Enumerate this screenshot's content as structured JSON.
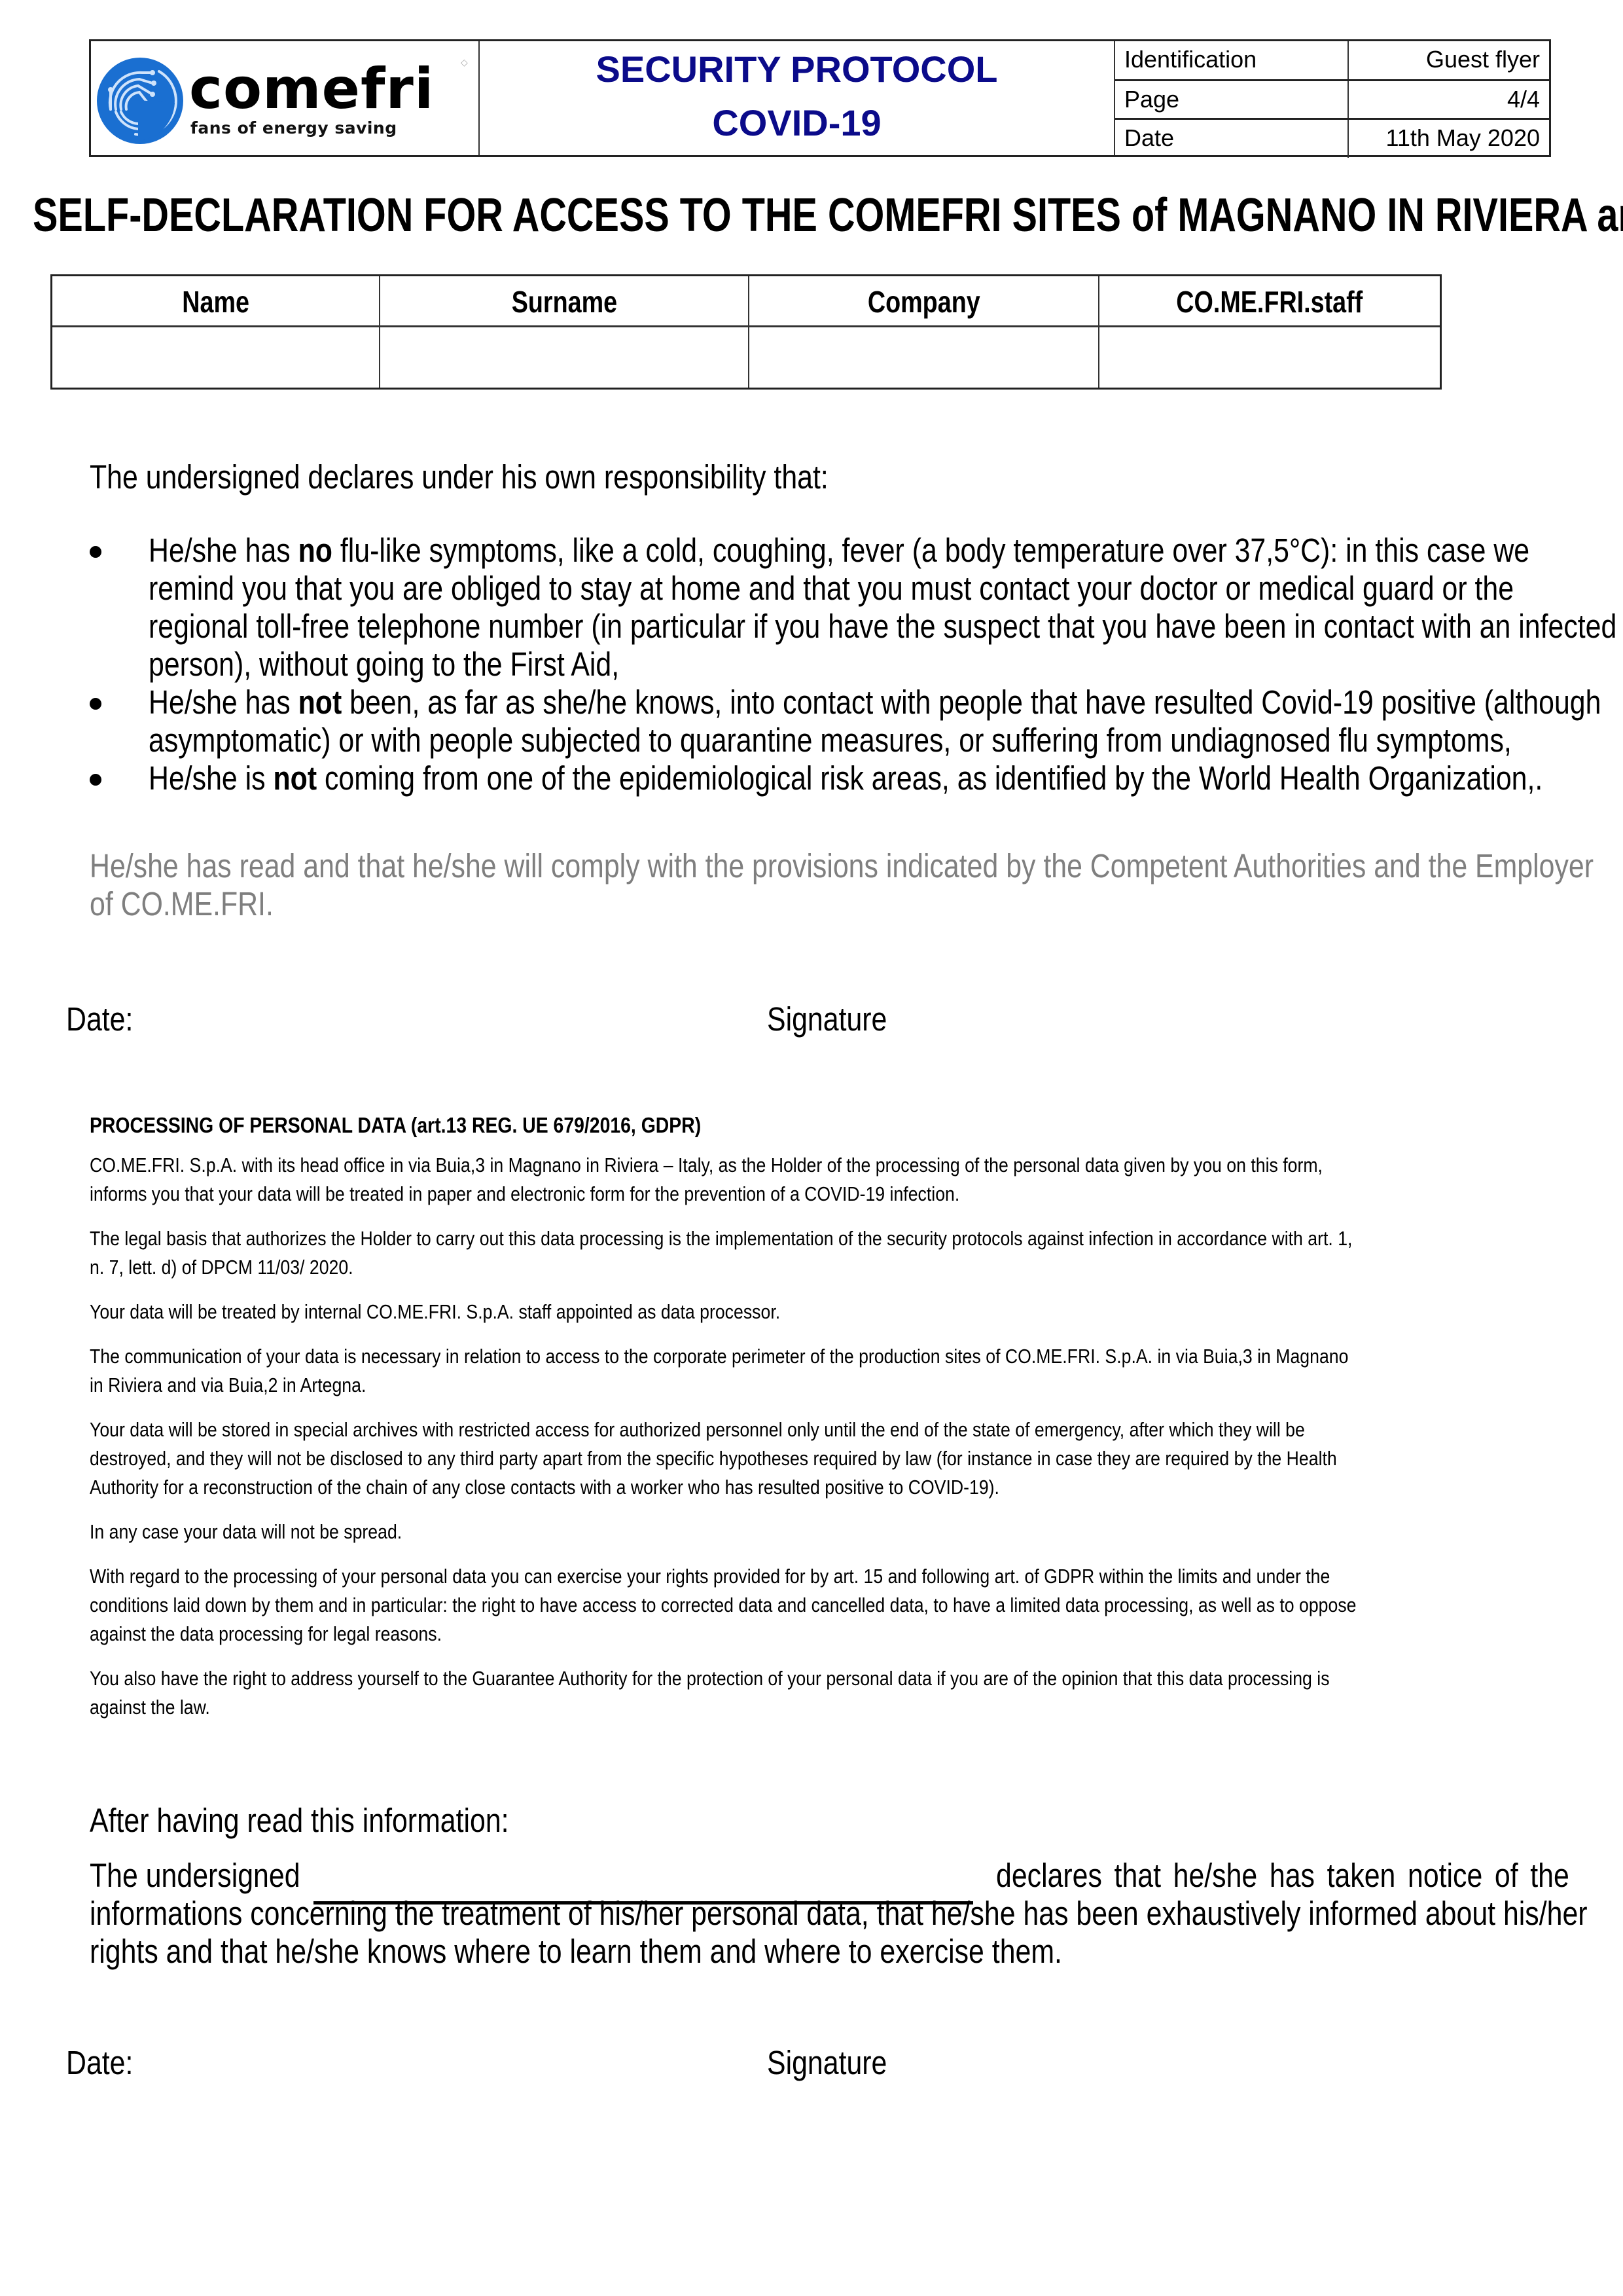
{
  "header": {
    "logo": {
      "brand": "comefri",
      "tagline": "fans of energy saving",
      "icon": "fan-circle-logo-icon",
      "brand_color": "#1a6fd1"
    },
    "protocol_title_line1": "SECURITY PROTOCOL",
    "protocol_title_line2": "COVID-19",
    "protocol_title_color": "#0b0b8a",
    "info": [
      {
        "label": "Identification",
        "value": "Guest flyer"
      },
      {
        "label": "Page",
        "value": "4/4"
      },
      {
        "label": "Date",
        "value": "11th May 2020"
      }
    ]
  },
  "title": "SELF-DECLARATION FOR ACCESS TO THE COMEFRI SITES of MAGNANO IN RIVIERA and ARTEGNA",
  "person_table": {
    "columns": [
      "Name",
      "Surname",
      "Company",
      "CO.ME.FRI.staff"
    ],
    "row": [
      "",
      "",
      "",
      ""
    ]
  },
  "declaration": {
    "intro": "The undersigned declares under his own responsibility that:",
    "bullets": [
      {
        "lines": [
          {
            "pre": "He/she has ",
            "bold": "no",
            "post": " flu-like symptoms, like a cold, coughing, fever (a body temperature over 37,5°C): in this case we"
          },
          {
            "pre": "remind you that you are obliged to stay at home and that you must contact your doctor or medical guard or the",
            "bold": "",
            "post": ""
          },
          {
            "pre": "regional toll-free telephone number (in particular if you have the suspect that you have been in contact with an infected",
            "bold": "",
            "post": ""
          },
          {
            "pre": "person), without going to the First Aid,",
            "bold": "",
            "post": ""
          }
        ]
      },
      {
        "lines": [
          {
            "pre": "He/she has ",
            "bold": "not",
            "post": " been, as far as she/he knows, into contact with people that have resulted Covid-19 positive (although"
          },
          {
            "pre": "asymptomatic) or with people subjected to quarantine measures, or suffering from undiagnosed flu symptoms,",
            "bold": "",
            "post": ""
          }
        ]
      },
      {
        "lines": [
          {
            "pre": "He/she is ",
            "bold": "not",
            "post": " coming  from one of the epidemiological risk areas, as identified by the World Health Organization,."
          }
        ]
      }
    ],
    "compliance_lines": [
      "He/she has read and that he/she will comply with the provisions indicated by the Competent Authorities and the Employer",
      "of CO.ME.FRI."
    ],
    "compliance_color": "#7f7f7f",
    "date_label": "Date:",
    "signature_label": "Signature"
  },
  "gdpr": {
    "heading": "PROCESSING OF PERSONAL DATA (art.13 REG. UE 679/2016, GDPR)",
    "paragraphs": [
      [
        "CO.ME.FRI. S.p.A. with its head office in via Buia,3 in Magnano in Riviera – Italy, as the Holder of the processing of the personal data given by you on this form,",
        "informs you that your data will be treated in paper and electronic form for the prevention of a COVID-19 infection."
      ],
      [
        "The legal basis that authorizes the Holder to carry out this data processing is the implementation of the security protocols against infection in accordance with art. 1,",
        "n. 7, lett. d) of  DPCM 11/03/ 2020."
      ],
      [
        "Your data will be treated by internal CO.ME.FRI. S.p.A. staff appointed as data processor."
      ],
      [
        "The communication of your data is necessary in relation to access to the corporate perimeter of the production sites of CO.ME.FRI. S.p.A. in via Buia,3 in Magnano",
        "in Riviera and via Buia,2 in Artegna."
      ],
      [
        "Your data will be stored in special archives with restricted access for authorized personnel only until the end of the state of emergency, after which they will be",
        "destroyed, and they will not be disclosed  to any third party apart from the specific hypotheses required by law (for instance in case they are required by the Health",
        "Authority for a reconstruction of the chain of any close contacts with a worker who has resulted positive to COVID-19)."
      ],
      [
        "In any case your data will not be spread."
      ],
      [
        "With regard to the processing of your personal data you can exercise your rights provided for by art. 15 and following art.  of GDPR within the limits and under the",
        "conditions laid down by them and in particular: the right to have access to corrected data and cancelled data, to have a limited data processing, as well as to oppose",
        "against the data processing for legal reasons."
      ],
      [
        "You also have the right to address yourself to the Guarantee Authority for the protection of your personal data if you are of the opinion that this data processing is",
        "against the law."
      ]
    ]
  },
  "acknowledgement": {
    "intro": "After having read this information:",
    "line1_pre": "The undersigned",
    "line1_blank": "",
    "line1_post": "declares that he/she has taken notice of the",
    "line2": "informations concerning the treatment of his/her personal data, that he/she has been exhaustively informed about his/her",
    "line3": "rights and that he/she knows where to learn them and where to exercise them.",
    "date_label": "Date:",
    "signature_label": "Signature"
  }
}
